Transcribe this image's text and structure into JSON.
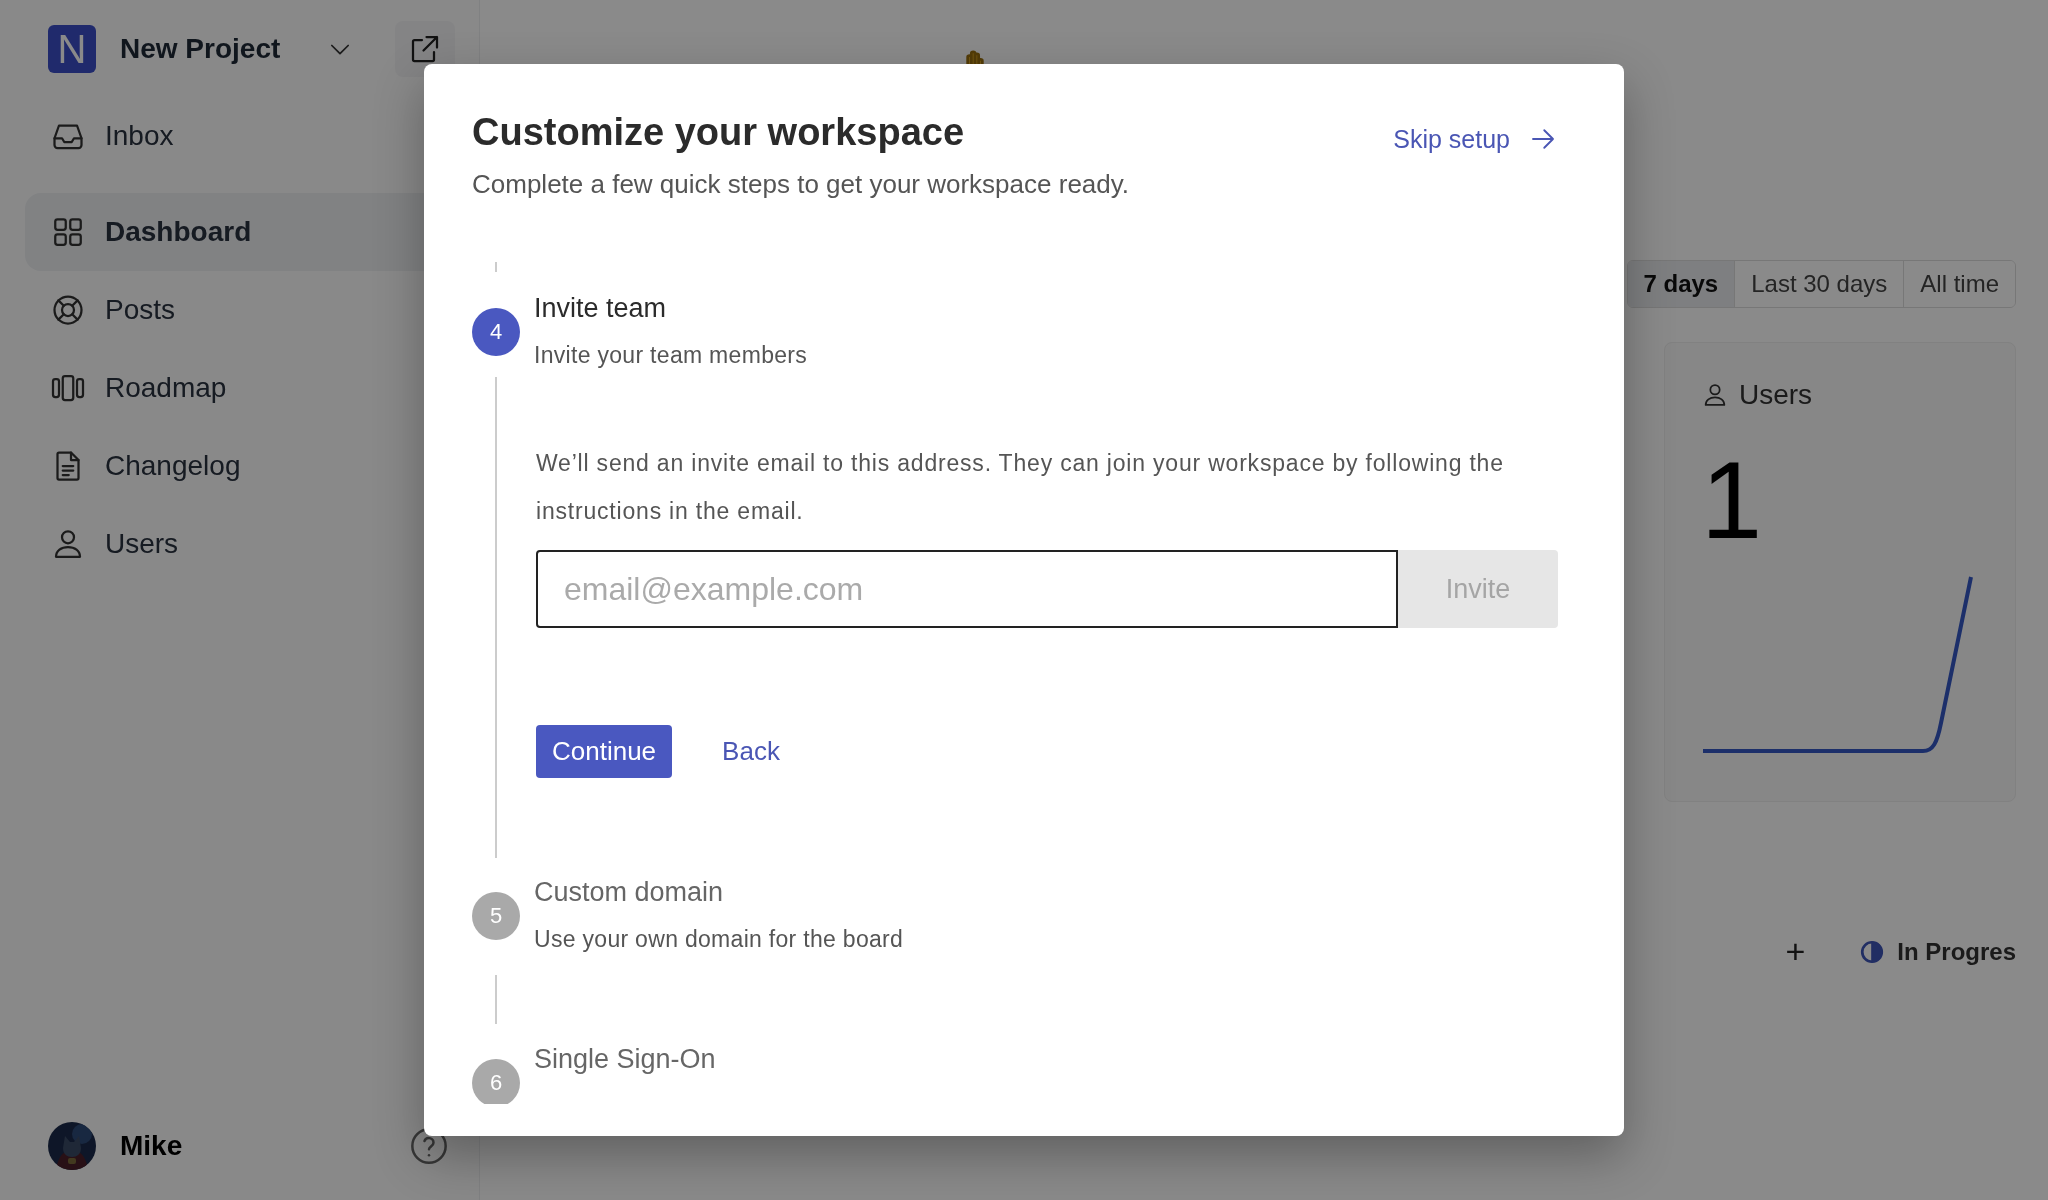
{
  "sidebar": {
    "project": {
      "logo_letter": "N",
      "name": "New Project"
    },
    "items": [
      {
        "label": "Inbox",
        "kind": "inbox",
        "selected": false
      },
      {
        "label": "Dashboard",
        "kind": "grid",
        "selected": true
      },
      {
        "label": "Posts",
        "kind": "lifebuoy",
        "selected": false
      },
      {
        "label": "Roadmap",
        "kind": "columns",
        "selected": false
      },
      {
        "label": "Changelog",
        "kind": "document",
        "selected": false
      },
      {
        "label": "Users",
        "kind": "person",
        "selected": false
      }
    ],
    "user": {
      "name": "Mike"
    }
  },
  "main": {
    "ranges": [
      {
        "label": "7 days",
        "selected": true
      },
      {
        "label": "Last 30 days",
        "selected": false
      },
      {
        "label": "All time",
        "selected": false
      }
    ],
    "card": {
      "title": "Users",
      "value": "1"
    },
    "add_symbol": "+",
    "status_label": "In Progres"
  },
  "dialog": {
    "title": "Customize your workspace",
    "subtitle": "Complete a few quick steps to get your workspace ready.",
    "skip_link": "Skip setup",
    "steps": [
      {
        "number": "4",
        "title": "Invite team",
        "description": "Invite your team members",
        "active": true
      },
      {
        "number": "5",
        "title": "Custom domain",
        "description": "Use your own domain for the board",
        "active": false
      },
      {
        "number": "6",
        "title": "Single Sign-On",
        "active": false
      }
    ],
    "invite": {
      "message": "We’ll send an invite email to this address. They can join your workspace by following the instructions in the email.",
      "email_field": {
        "placeholder": "email@example.com"
      },
      "invite_button": {
        "label": "Invite",
        "disabled": true
      },
      "continue_button": "Continue",
      "back_link": "Back"
    }
  }
}
